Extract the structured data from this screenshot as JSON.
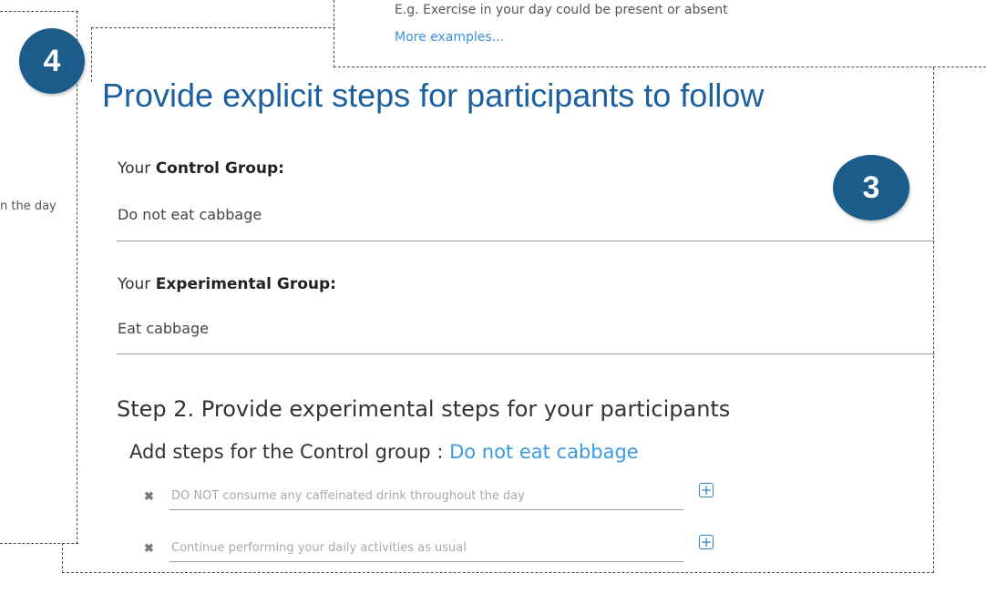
{
  "top_panel": {
    "example_text": "E.g. Exercise in your day could be present or absent",
    "more_examples_link": "More examples..."
  },
  "left_panel": {
    "fragment_text": "n the day"
  },
  "badges": {
    "left_number": "4",
    "right_number": "3"
  },
  "main": {
    "heading": "Provide explicit steps for participants to follow",
    "control": {
      "label_prefix": "Your ",
      "label_bold": "Control Group:",
      "value": "Do not eat cabbage"
    },
    "experimental": {
      "label_prefix": "Your ",
      "label_bold": "Experimental Group:",
      "value": "Eat cabbage"
    },
    "step2_title": "Step 2. Provide experimental steps for your participants",
    "add_steps_prefix": "Add steps for the Control group : ",
    "add_steps_group_link": "Do not eat cabbage",
    "steps": [
      {
        "placeholder": "DO NOT consume any caffeinated drink throughout the day"
      },
      {
        "placeholder": "Continue performing your daily activities as usual"
      }
    ]
  },
  "icons": {
    "remove": "close-icon",
    "add": "plus-square-icon"
  },
  "colors": {
    "badge": "#1c5c8a",
    "heading": "#1b5f9e",
    "link": "#3a8fd8",
    "add_icon": "#2f80c9"
  }
}
